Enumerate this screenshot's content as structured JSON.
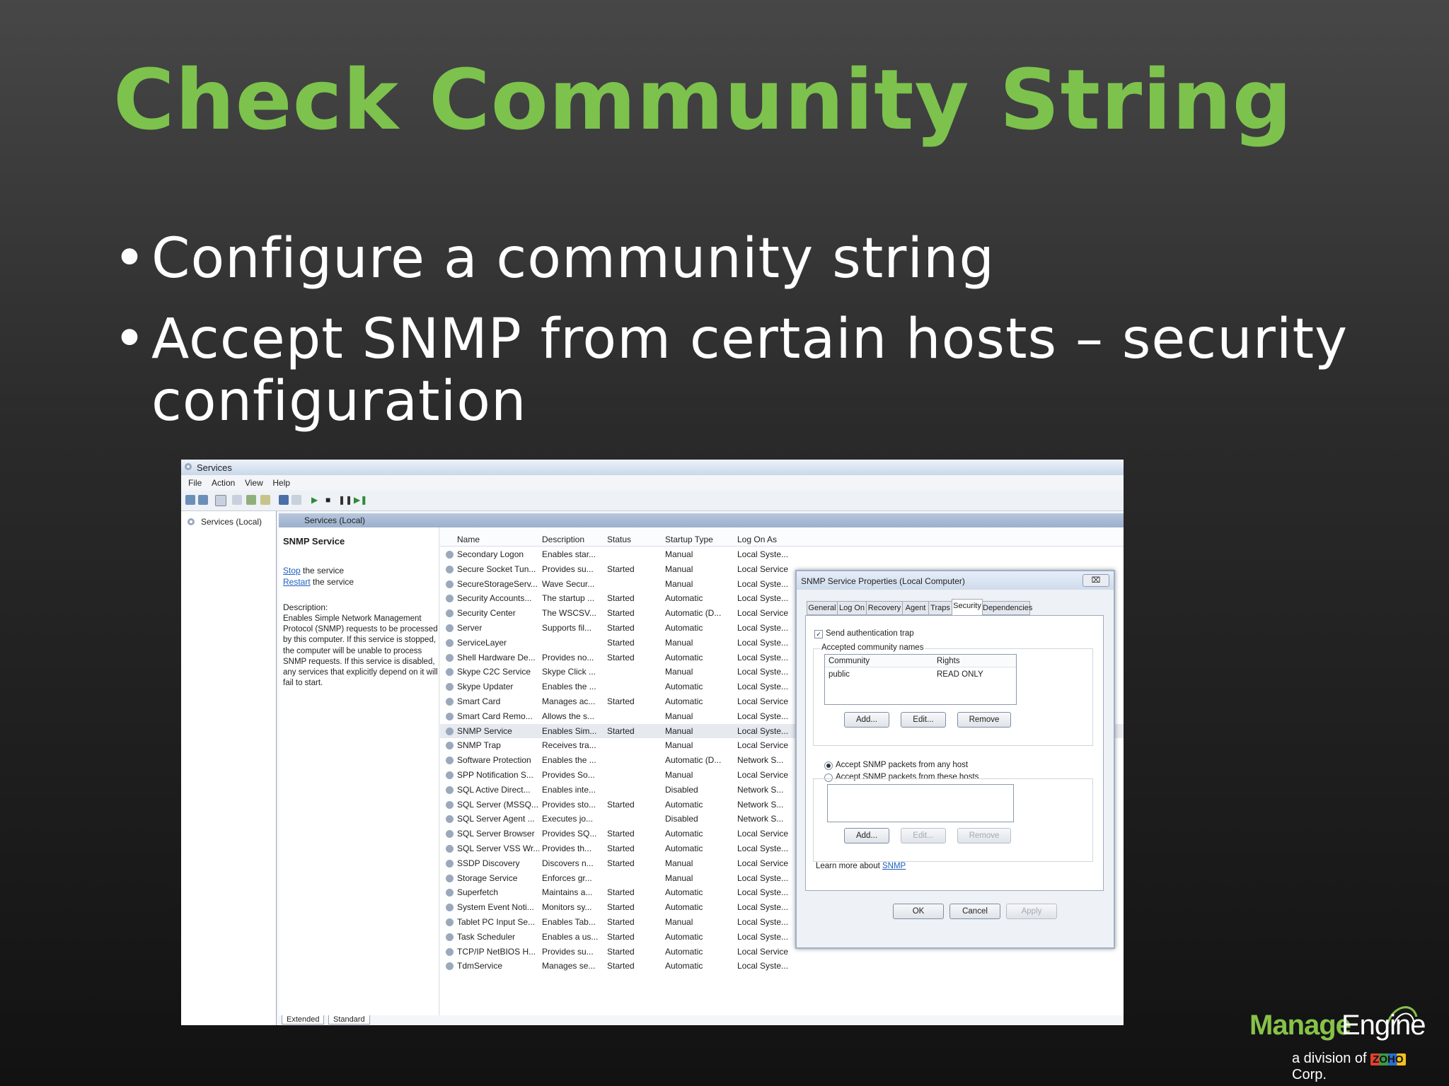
{
  "slide": {
    "title": "Check Community String",
    "bullets": [
      "Configure a community string",
      "Accept SNMP from certain hosts – security configuration"
    ]
  },
  "services_window": {
    "title": "Services",
    "menu": [
      "File",
      "Action",
      "View",
      "Help"
    ],
    "tree_root": "Services (Local)",
    "pane_header": "Services (Local)",
    "selected_service": "SNMP Service",
    "stop_link": "Stop",
    "stop_rest": " the service",
    "restart_link": "Restart",
    "restart_rest": " the service",
    "description_label": "Description:",
    "description_text": "Enables Simple Network Management Protocol (SNMP) requests to be processed by this computer. If this service is stopped, the computer will be unable to process SNMP requests. If this service is disabled, any services that explicitly depend on it will fail to start.",
    "columns": [
      "Name",
      "Description",
      "Status",
      "Startup Type",
      "Log On As"
    ],
    "rows": [
      {
        "name": "Secondary Logon",
        "desc": "Enables star...",
        "status": "",
        "startup": "Manual",
        "logon": "Local Syste..."
      },
      {
        "name": "Secure Socket Tun...",
        "desc": "Provides su...",
        "status": "Started",
        "startup": "Manual",
        "logon": "Local Service"
      },
      {
        "name": "SecureStorageServ...",
        "desc": "Wave Secur...",
        "status": "",
        "startup": "Manual",
        "logon": "Local Syste..."
      },
      {
        "name": "Security Accounts...",
        "desc": "The startup ...",
        "status": "Started",
        "startup": "Automatic",
        "logon": "Local Syste..."
      },
      {
        "name": "Security Center",
        "desc": "The WSCSV...",
        "status": "Started",
        "startup": "Automatic (D...",
        "logon": "Local Service"
      },
      {
        "name": "Server",
        "desc": "Supports fil...",
        "status": "Started",
        "startup": "Automatic",
        "logon": "Local Syste..."
      },
      {
        "name": "ServiceLayer",
        "desc": "",
        "status": "Started",
        "startup": "Manual",
        "logon": "Local Syste..."
      },
      {
        "name": "Shell Hardware De...",
        "desc": "Provides no...",
        "status": "Started",
        "startup": "Automatic",
        "logon": "Local Syste..."
      },
      {
        "name": "Skype C2C Service",
        "desc": "Skype Click ...",
        "status": "",
        "startup": "Manual",
        "logon": "Local Syste..."
      },
      {
        "name": "Skype Updater",
        "desc": "Enables the ...",
        "status": "",
        "startup": "Automatic",
        "logon": "Local Syste..."
      },
      {
        "name": "Smart Card",
        "desc": "Manages ac...",
        "status": "Started",
        "startup": "Automatic",
        "logon": "Local Service"
      },
      {
        "name": "Smart Card Remo...",
        "desc": "Allows the s...",
        "status": "",
        "startup": "Manual",
        "logon": "Local Syste..."
      },
      {
        "name": "SNMP Service",
        "desc": "Enables Sim...",
        "status": "Started",
        "startup": "Manual",
        "logon": "Local Syste..."
      },
      {
        "name": "SNMP Trap",
        "desc": "Receives tra...",
        "status": "",
        "startup": "Manual",
        "logon": "Local Service"
      },
      {
        "name": "Software Protection",
        "desc": "Enables the ...",
        "status": "",
        "startup": "Automatic (D...",
        "logon": "Network S..."
      },
      {
        "name": "SPP Notification S...",
        "desc": "Provides So...",
        "status": "",
        "startup": "Manual",
        "logon": "Local Service"
      },
      {
        "name": "SQL Active Direct...",
        "desc": "Enables inte...",
        "status": "",
        "startup": "Disabled",
        "logon": "Network S..."
      },
      {
        "name": "SQL Server (MSSQ...",
        "desc": "Provides sto...",
        "status": "Started",
        "startup": "Automatic",
        "logon": "Network S..."
      },
      {
        "name": "SQL Server Agent ...",
        "desc": "Executes jo...",
        "status": "",
        "startup": "Disabled",
        "logon": "Network S..."
      },
      {
        "name": "SQL Server Browser",
        "desc": "Provides SQ...",
        "status": "Started",
        "startup": "Automatic",
        "logon": "Local Service"
      },
      {
        "name": "SQL Server VSS Wr...",
        "desc": "Provides th...",
        "status": "Started",
        "startup": "Automatic",
        "logon": "Local Syste..."
      },
      {
        "name": "SSDP Discovery",
        "desc": "Discovers n...",
        "status": "Started",
        "startup": "Manual",
        "logon": "Local Service"
      },
      {
        "name": "Storage Service",
        "desc": "Enforces gr...",
        "status": "",
        "startup": "Manual",
        "logon": "Local Syste..."
      },
      {
        "name": "Superfetch",
        "desc": "Maintains a...",
        "status": "Started",
        "startup": "Automatic",
        "logon": "Local Syste..."
      },
      {
        "name": "System Event Noti...",
        "desc": "Monitors sy...",
        "status": "Started",
        "startup": "Automatic",
        "logon": "Local Syste..."
      },
      {
        "name": "Tablet PC Input Se...",
        "desc": "Enables Tab...",
        "status": "Started",
        "startup": "Manual",
        "logon": "Local Syste..."
      },
      {
        "name": "Task Scheduler",
        "desc": "Enables a us...",
        "status": "Started",
        "startup": "Automatic",
        "logon": "Local Syste..."
      },
      {
        "name": "TCP/IP NetBIOS H...",
        "desc": "Provides su...",
        "status": "Started",
        "startup": "Automatic",
        "logon": "Local Service"
      },
      {
        "name": "TdmService",
        "desc": "Manages se...",
        "status": "Started",
        "startup": "Automatic",
        "logon": "Local Syste..."
      }
    ],
    "bottom_tabs": [
      "Extended",
      "Standard"
    ]
  },
  "snmp_dialog": {
    "title": "SNMP Service Properties (Local Computer)",
    "close": "⌧",
    "tabs": [
      "General",
      "Log On",
      "Recovery",
      "Agent",
      "Traps",
      "Security",
      "Dependencies"
    ],
    "active_tab": "Security",
    "send_auth_trap": "Send authentication trap",
    "accepted_group": "Accepted community names",
    "col_community": "Community",
    "col_rights": "Rights",
    "community_name": "public",
    "community_rights": "READ ONLY",
    "add": "Add...",
    "edit": "Edit...",
    "remove": "Remove",
    "accept_any": "Accept SNMP packets from any host",
    "accept_these": "Accept SNMP packets from these hosts",
    "learn_more": "Learn more about ",
    "learn_link": "SNMP",
    "ok": "OK",
    "cancel": "Cancel",
    "apply": "Apply"
  },
  "logo": {
    "brand_part1": "Manage",
    "brand_part2": "Engine",
    "division_prefix": "a division of ",
    "division_zoho": "ZOHO",
    "division_suffix": " Corp."
  },
  "colors": {
    "title_green": "#7cc24d",
    "text_white": "#ffffff",
    "link_blue": "#1f5fbf"
  }
}
